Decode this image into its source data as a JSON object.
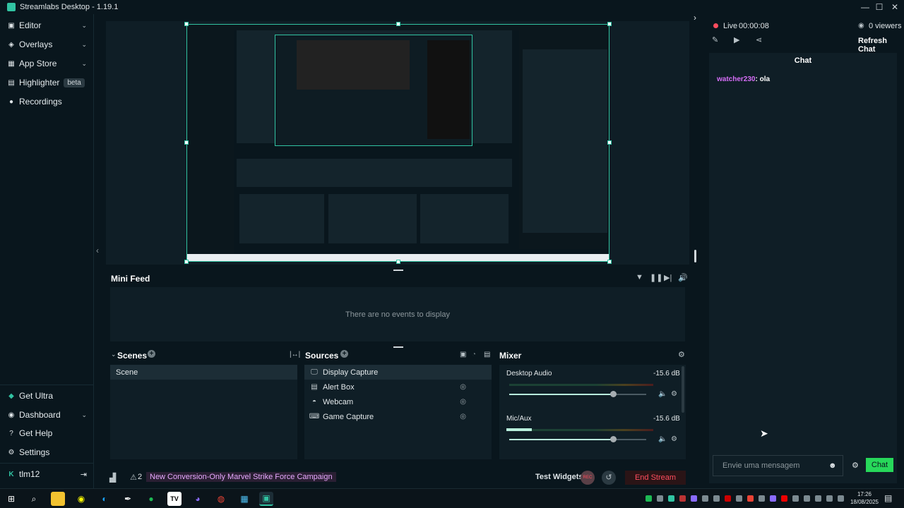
{
  "window": {
    "title": "Streamlabs Desktop - 1.19.1",
    "minimize": "—",
    "maximize": "☐",
    "close": "✕"
  },
  "sidebar": {
    "items": [
      {
        "label": "Editor",
        "icon": "▣"
      },
      {
        "label": "Overlays",
        "icon": "◈"
      },
      {
        "label": "App Store",
        "icon": "▦"
      },
      {
        "label": "Highlighter",
        "icon": "▤",
        "badge": "beta"
      },
      {
        "label": "Recordings",
        "icon": "●"
      }
    ],
    "bottom_items": [
      {
        "label": "Get Ultra",
        "icon": "◆"
      },
      {
        "label": "Dashboard",
        "icon": "◉"
      },
      {
        "label": "Get Help",
        "icon": "?"
      },
      {
        "label": "Settings",
        "icon": "⚙"
      }
    ],
    "user": {
      "name": "tlm12",
      "logout_icon": "⇥"
    },
    "chevron": "⌄"
  },
  "mini_feed": {
    "title": "Mini Feed",
    "empty_text": "There are no events to display"
  },
  "scenes": {
    "title": "Scenes",
    "items": [
      "Scene"
    ]
  },
  "sources": {
    "title": "Sources",
    "items": [
      {
        "label": "Display Capture",
        "icon": "🖵"
      },
      {
        "label": "Alert Box",
        "icon": "▤"
      },
      {
        "label": "Webcam",
        "icon": "◓"
      },
      {
        "label": "Game Capture",
        "icon": "⌨"
      }
    ]
  },
  "mixer": {
    "title": "Mixer",
    "channels": [
      {
        "name": "Desktop Audio",
        "db": "-15.6 dB",
        "level": 0.76
      },
      {
        "name": "Mic/Aux",
        "db": "-15.6 dB",
        "level": 0.76
      }
    ]
  },
  "footer": {
    "notification_count": "2",
    "campaign": "New Conversion-Only Marvel Strike Force Campaign",
    "test_widgets": "Test Widgets",
    "rec_label": "REC",
    "end_stream": "End Stream"
  },
  "stream": {
    "live_label": "Live",
    "time": "00:00:08",
    "viewers": "0 viewers",
    "refresh_chat": "Refresh Chat"
  },
  "chat": {
    "title": "Chat",
    "messages": [
      {
        "user": "watcher230",
        "text": ": ola"
      }
    ],
    "input_placeholder": "Envie uma mensagem",
    "send_label": "Chat"
  },
  "taskbar": {
    "time": "17:26",
    "date": "18/08/2025"
  },
  "colors": {
    "accent": "#31c3a2",
    "bg": "#09161d",
    "panel": "#0f1e26",
    "danger": "#ff4d5e",
    "chat_user": "#d76ef8",
    "chat_button": "#27d85a"
  }
}
